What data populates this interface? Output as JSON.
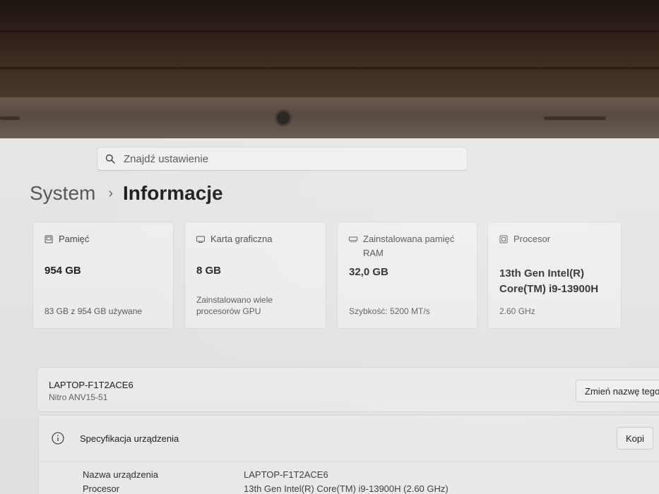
{
  "search": {
    "placeholder": "Znajdź ustawienie"
  },
  "breadcrumb": {
    "parent": "System",
    "separator": "›",
    "current": "Informacje"
  },
  "cards": [
    {
      "title": "Pamięć",
      "value": "954 GB",
      "sub": "83 GB z 954 GB używane",
      "icon": "storage-icon"
    },
    {
      "title": "Karta graficzna",
      "value": "8 GB",
      "sub": "Zainstalowano wiele procesorów GPU",
      "icon": "gpu-icon"
    },
    {
      "title": "Zainstalowana pamięć RAM",
      "value": "32,0 GB",
      "sub": "Szybkość: 5200 MT/s",
      "icon": "ram-icon"
    },
    {
      "title": "Procesor",
      "value": "13th Gen Intel(R) Core(TM) i9-13900H",
      "sub": "2.60 GHz",
      "icon": "cpu-icon"
    }
  ],
  "device": {
    "name": "LAPTOP-F1T2ACE6",
    "model": "Nitro ANV15-51",
    "rename_label": "Zmień nazwę tego"
  },
  "specs": {
    "title": "Specyfikacja urządzenia",
    "copy_label": "Kopi",
    "rows": [
      {
        "label": "Nazwa urządzenia",
        "value": "LAPTOP-F1T2ACE6"
      },
      {
        "label": "Procesor",
        "value": "13th Gen Intel(R) Core(TM) i9-13900H (2.60 GHz)"
      }
    ]
  },
  "colors": {
    "background": "#ededed",
    "card": "#f6f6f6",
    "border": "#e2e2e2"
  }
}
